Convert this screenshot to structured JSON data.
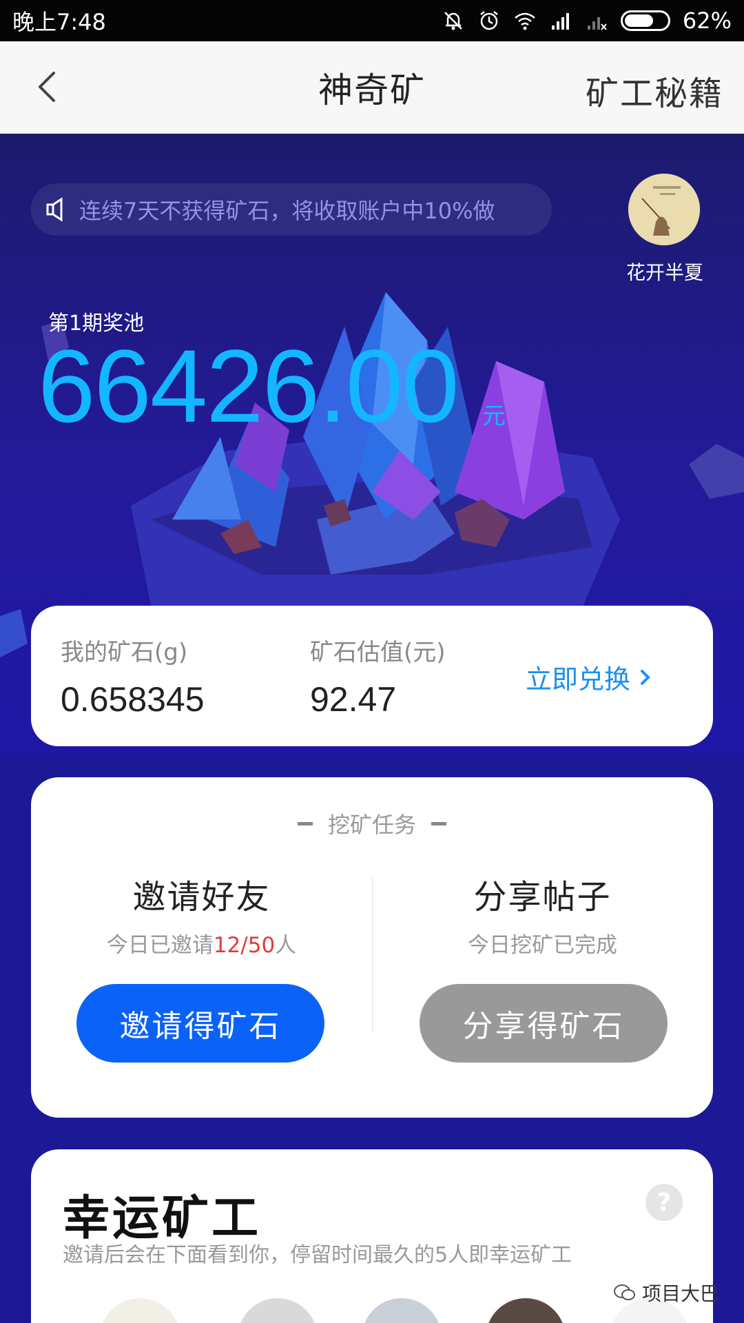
{
  "status_bar": {
    "time": "晚上7:48",
    "battery": "62%",
    "icons": [
      "bell-off-icon",
      "alarm-icon",
      "wifi-icon",
      "signal-icon",
      "signal-x-icon",
      "battery-icon"
    ]
  },
  "nav": {
    "title": "神奇矿",
    "right_label": "矿工秘籍"
  },
  "hero": {
    "notice": "连续7天不获得矿石，将收取账户中10%做",
    "user_name": "花开半夏",
    "pool_label": "第1期奖池",
    "pool_amount": "66426.00",
    "pool_unit": "元"
  },
  "ore": {
    "my_ore_label": "我的矿石(g)",
    "my_ore_value": "0.658345",
    "value_label": "矿石估值(元)",
    "value_value": "92.47",
    "exchange_label": "立即兑换"
  },
  "tasks": {
    "title": "挖矿任务",
    "invite": {
      "name": "邀请好友",
      "sub_prefix": "今日已邀请",
      "sub_count": "12/50",
      "sub_suffix": "人",
      "button": "邀请得矿石"
    },
    "share": {
      "name": "分享帖子",
      "sub": "今日挖矿已完成",
      "button": "分享得矿石"
    }
  },
  "lucky": {
    "title": "幸运矿工",
    "help": "?",
    "subtitle": "邀请后会在下面看到你，停留时间最久的5人即幸运矿工"
  },
  "watermark": "项目大巴",
  "colors": {
    "accent_blue": "#14b6ff",
    "button_blue": "#0b62f8",
    "button_gray": "#999999",
    "highlight_red": "#e23b3b",
    "hero_bg": "#1d1896"
  }
}
